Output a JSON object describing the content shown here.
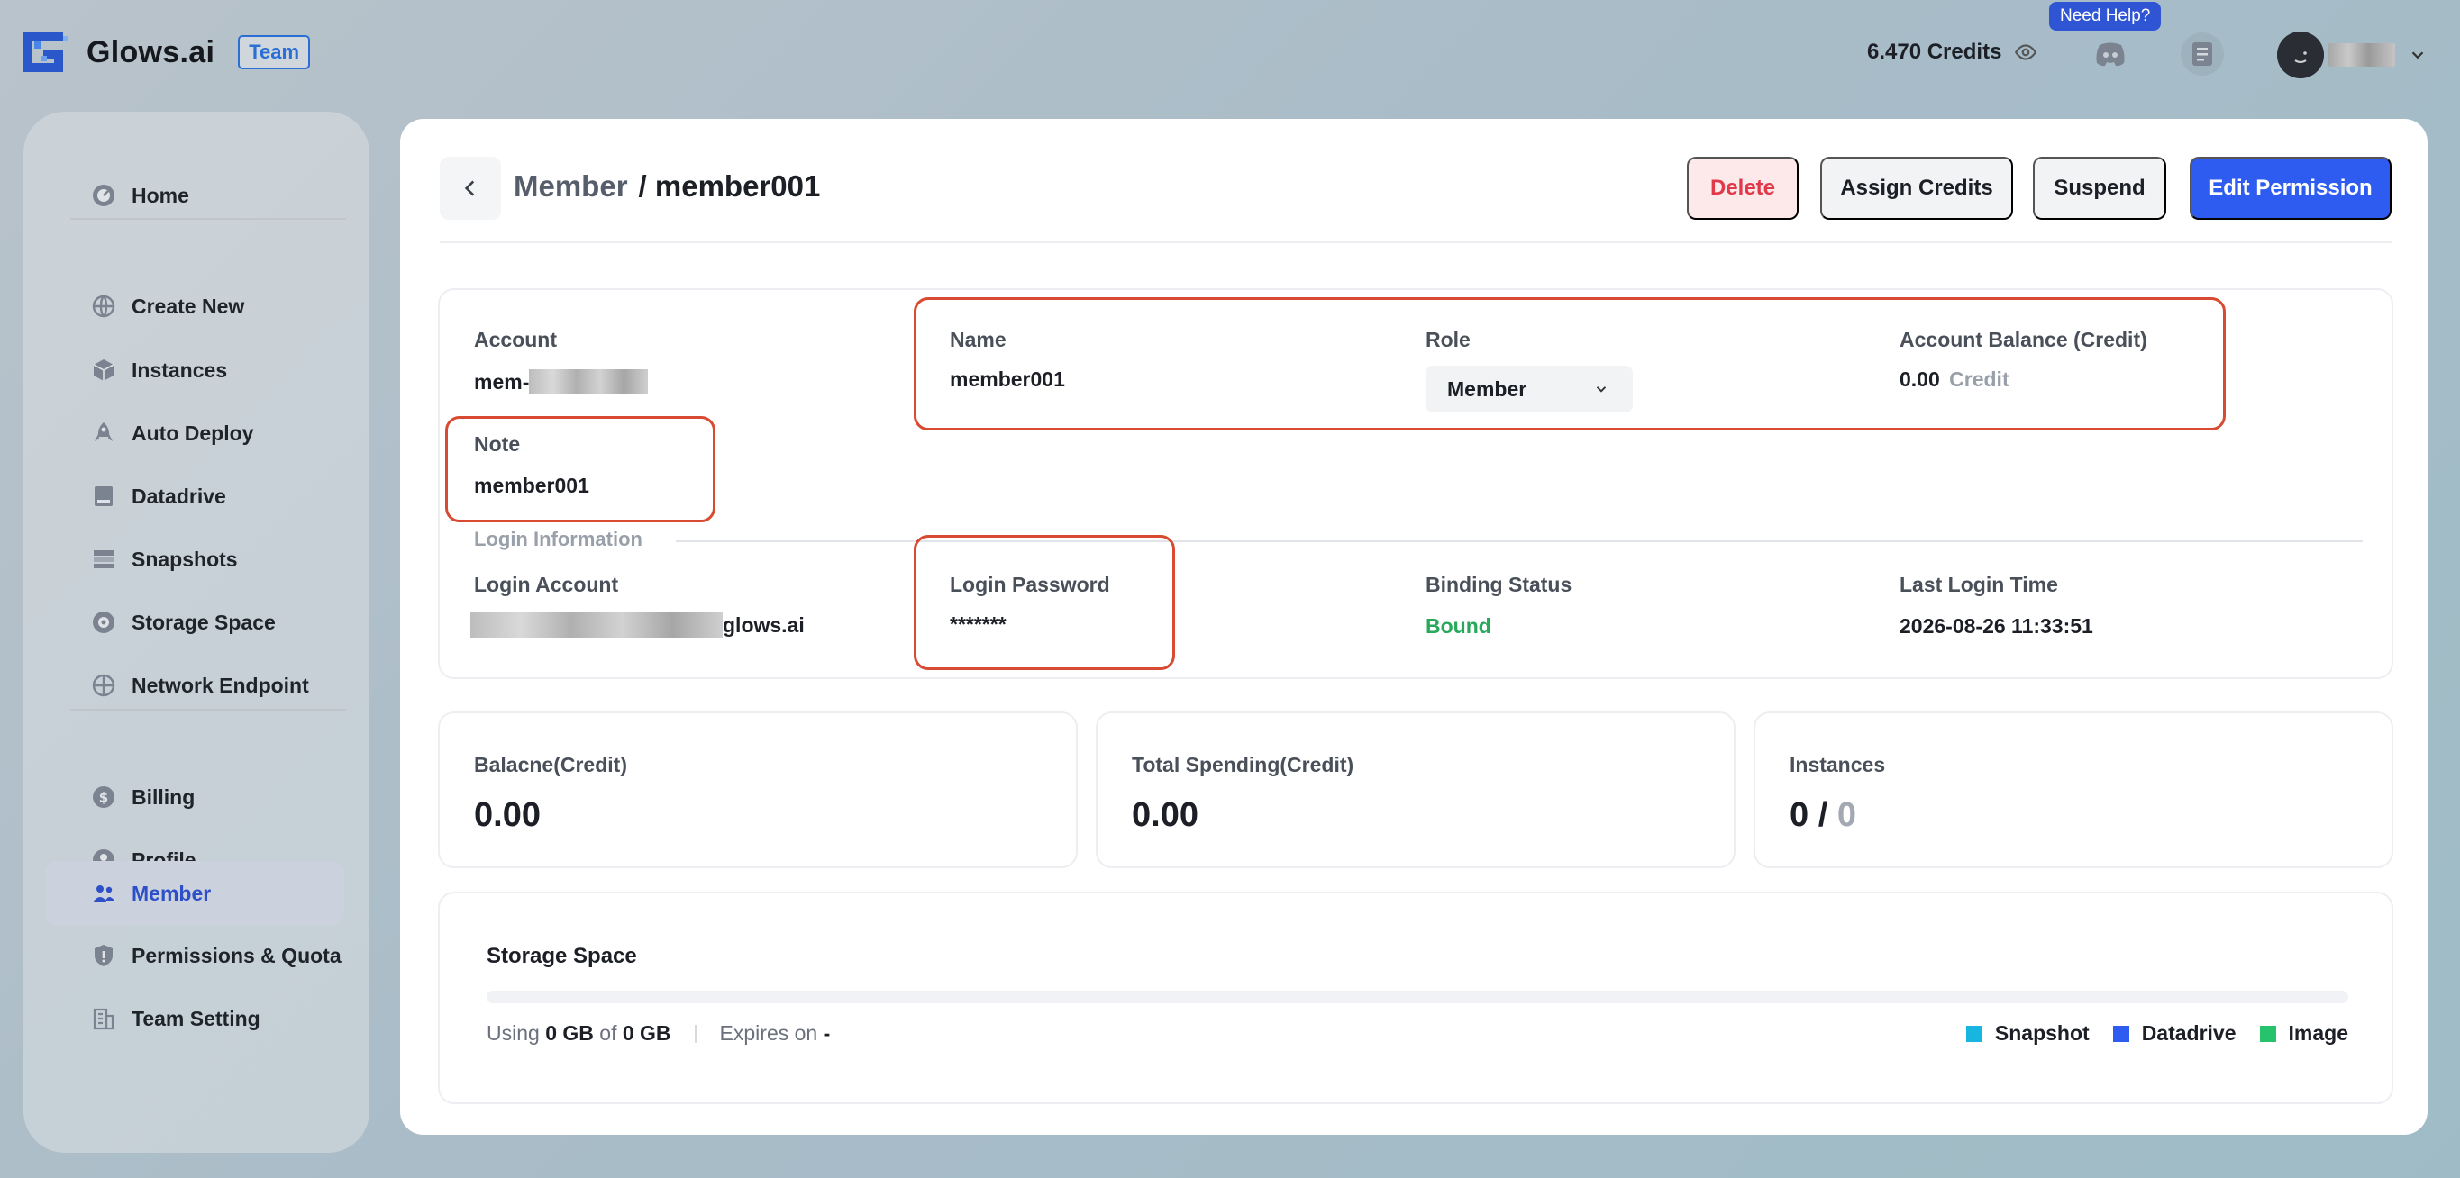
{
  "header": {
    "brand": "Glows.ai",
    "team_badge": "Team",
    "credits": "6.470 Credits",
    "help_badge": "Need Help?"
  },
  "sidebar": {
    "items": [
      {
        "label": "Home",
        "icon": "dashboard-icon"
      },
      {
        "label": "Create New",
        "icon": "globe-icon"
      },
      {
        "label": "Instances",
        "icon": "cube-icon"
      },
      {
        "label": "Auto Deploy",
        "icon": "rocket-icon"
      },
      {
        "label": "Datadrive",
        "icon": "drive-icon"
      },
      {
        "label": "Snapshots",
        "icon": "snapshot-icon"
      },
      {
        "label": "Storage Space",
        "icon": "storage-icon"
      },
      {
        "label": "Network Endpoint",
        "icon": "network-icon"
      },
      {
        "label": "Billing",
        "icon": "coin-icon"
      },
      {
        "label": "Profile",
        "icon": "user-icon"
      },
      {
        "label": "Member",
        "icon": "members-icon"
      },
      {
        "label": "Permissions & Quota",
        "icon": "shield-icon"
      },
      {
        "label": "Team Setting",
        "icon": "building-icon"
      }
    ],
    "active": "Member"
  },
  "page": {
    "breadcrumb_parent": "Member",
    "breadcrumb_current": "/ member001",
    "buttons": {
      "delete": "Delete",
      "assign_credits": "Assign Credits",
      "suspend": "Suspend",
      "edit_permission": "Edit Permission"
    }
  },
  "account_info": {
    "account_label": "Account",
    "account_value_prefix": "mem-",
    "name_label": "Name",
    "name_value": "member001",
    "role_label": "Role",
    "role_value": "Member",
    "balance_label": "Account Balance (Credit)",
    "balance_value": "0.00",
    "balance_unit": "Credit",
    "note_label": "Note",
    "note_value": "member001",
    "login_section_label": "Login Information",
    "login_account_label": "Login Account",
    "login_account_suffix": "glows.ai",
    "login_password_label": "Login Password",
    "login_password_value": "*******",
    "binding_status_label": "Binding Status",
    "binding_status_value": "Bound",
    "last_login_label": "Last Login Time",
    "last_login_value": "2026-08-26 11:33:51"
  },
  "stats": {
    "balance_label": "Balacne(Credit)",
    "balance_value": "0.00",
    "spending_label": "Total Spending(Credit)",
    "spending_value": "0.00",
    "instances_label": "Instances",
    "instances_used": "0",
    "instances_sep": "/",
    "instances_total": "0"
  },
  "storage": {
    "title": "Storage Space",
    "using_label": "Using",
    "used": "0 GB",
    "of_label": "of",
    "total": "0 GB",
    "expires_label": "Expires on",
    "expires_value": "-",
    "usage_fraction": 0,
    "legend": [
      {
        "label": "Snapshot",
        "color": "#17b6e0"
      },
      {
        "label": "Datadrive",
        "color": "#2f5cf0"
      },
      {
        "label": "Image",
        "color": "#27c26c"
      }
    ]
  },
  "colors": {
    "accent": "#2f5cf0",
    "danger": "#e03a4a",
    "success": "#27a85b",
    "highlight_box": "#d84a32"
  }
}
